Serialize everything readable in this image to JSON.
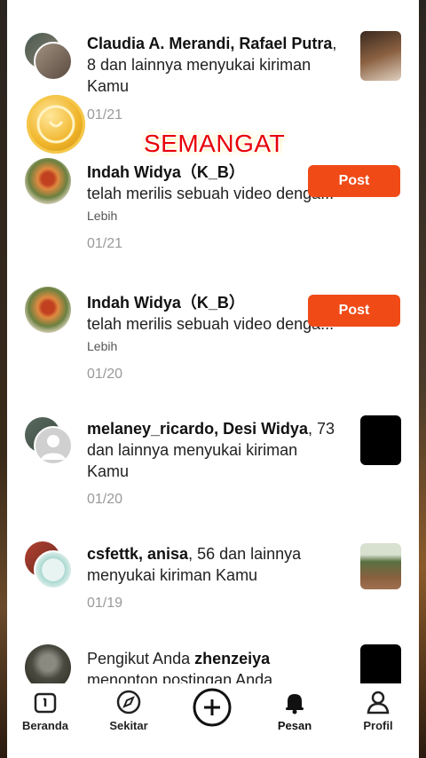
{
  "notifications": [
    {
      "names": "Claudia A. Merandi, Rafael Putra",
      "rest": ", 8 dan lainnya menyukai kiriman Kamu",
      "date": "01/21"
    },
    {
      "names": "Indah Widya（K_B）",
      "rest": "telah merilis sebuah video denga...",
      "more": "Lebih",
      "date": "01/21",
      "button": "Post"
    },
    {
      "names": "Indah Widya（K_B）",
      "rest": "telah merilis sebuah video denga...",
      "more": "Lebih",
      "date": "01/20",
      "button": "Post"
    },
    {
      "names": "melaney_ricardo, Desi Widya",
      "rest": ", 73 dan lainnya menyukai kiriman Kamu",
      "date": "01/20"
    },
    {
      "names": "csfettk, anisa",
      "rest": ", 56 dan lainnya menyukai kiriman Kamu",
      "date": "01/19"
    },
    {
      "prefix": "Pengikut  Anda ",
      "names": "zhenzeiya",
      "rest": "menonton postingan Anda"
    }
  ],
  "overlay_text": "SEMANGAT",
  "nav": {
    "home": "Beranda",
    "nearby": "Sekitar",
    "messages": "Pesan",
    "profile": "Profil"
  },
  "colors": {
    "accent": "#f04a17",
    "overlay_text": "#e8000a"
  }
}
